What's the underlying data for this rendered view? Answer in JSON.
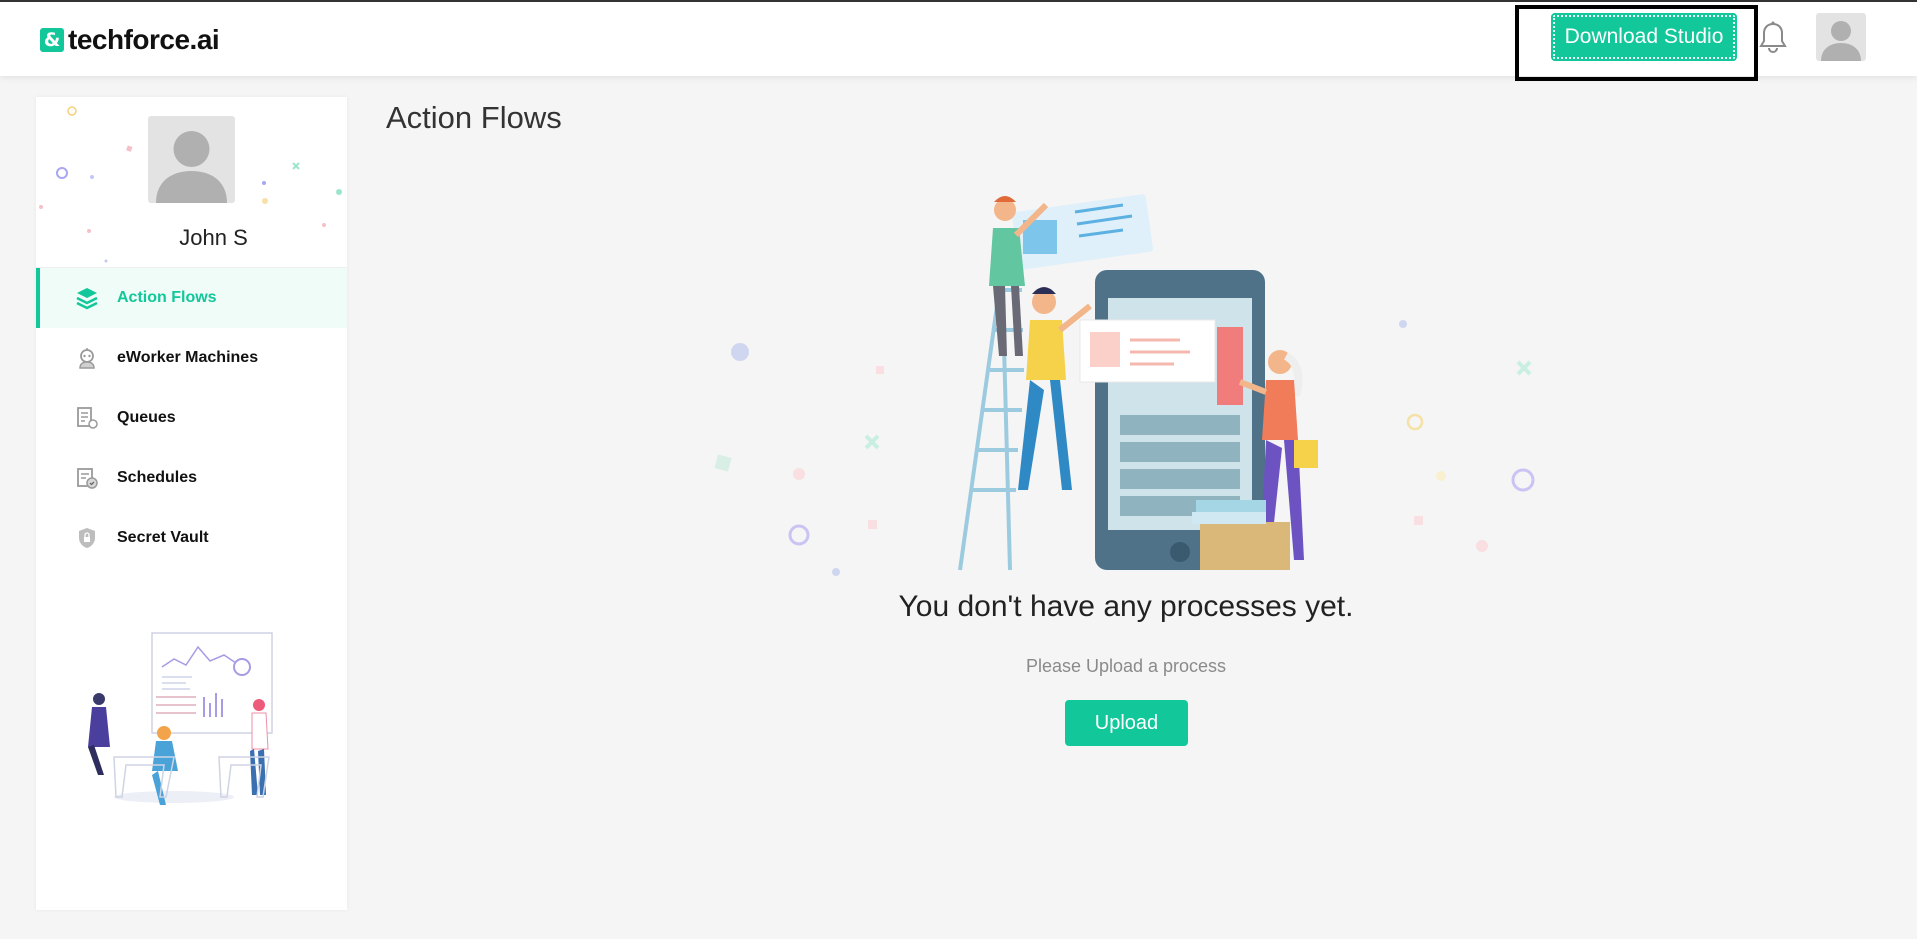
{
  "brand": {
    "logo_mark": "&",
    "logo_text": "techforce.ai"
  },
  "header": {
    "download_button": "Download Studio",
    "notification_icon": "bell-icon",
    "avatar_icon": "user-avatar-icon"
  },
  "user": {
    "name": "John S"
  },
  "sidebar": {
    "items": [
      {
        "label": "Action Flows",
        "icon": "layers-icon",
        "active": true
      },
      {
        "label": "eWorker Machines",
        "icon": "robot-icon",
        "active": false
      },
      {
        "label": "Queues",
        "icon": "queue-document-icon",
        "active": false
      },
      {
        "label": "Schedules",
        "icon": "schedule-clock-icon",
        "active": false
      },
      {
        "label": "Secret Vault",
        "icon": "shield-lock-icon",
        "active": false
      }
    ]
  },
  "main": {
    "title": "Action Flows",
    "empty_title": "You don't have any processes yet.",
    "empty_subtitle": "Please Upload a process",
    "upload_button": "Upload"
  },
  "colors": {
    "accent": "#12c79a",
    "background": "#f5f5f5"
  }
}
